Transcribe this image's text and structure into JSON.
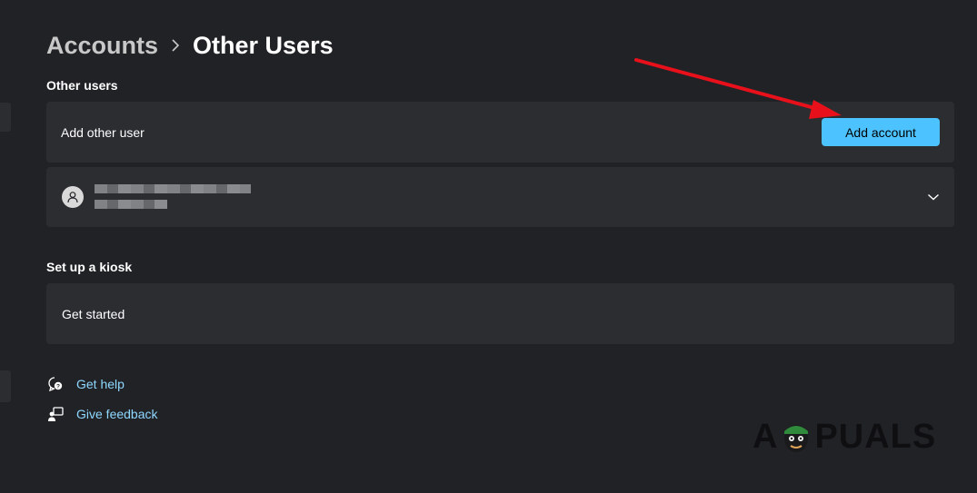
{
  "breadcrumb": {
    "parent": "Accounts",
    "current": "Other Users"
  },
  "other_users": {
    "title": "Other users",
    "add_label": "Add other user",
    "add_button": "Add account"
  },
  "kiosk": {
    "title": "Set up a kiosk",
    "action": "Get started"
  },
  "links": {
    "help": "Get help",
    "feedback": "Give feedback"
  },
  "watermark": {
    "a": "A",
    "rest": "PUALS"
  },
  "icons": {
    "breadcrumb_sep": "chevron-right-icon",
    "avatar": "person-icon",
    "expand": "chevron-down-icon",
    "help": "help-chat-icon",
    "feedback": "feedback-icon"
  },
  "colors": {
    "accent": "#4cc2ff",
    "annotation_arrow": "#e8101a",
    "link": "#8fd8ff"
  }
}
